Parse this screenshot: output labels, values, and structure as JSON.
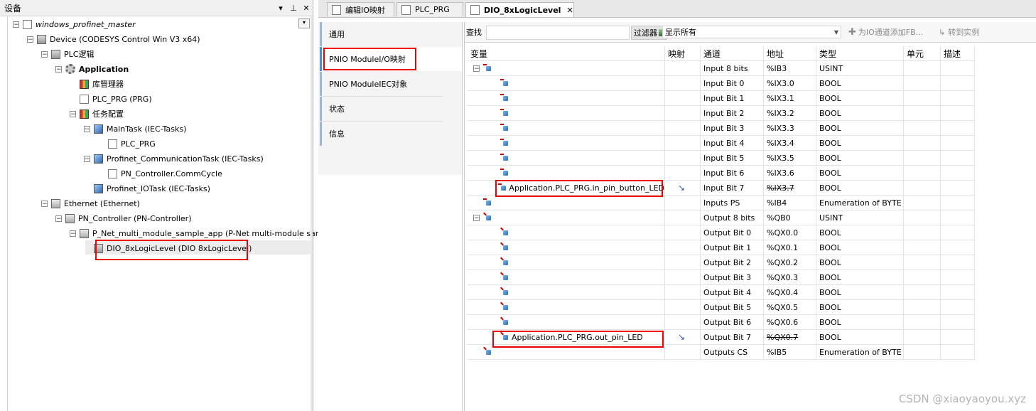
{
  "left_pane": {
    "title": "设备",
    "buttons": [
      "▾",
      "⊥",
      "✕"
    ],
    "tree": [
      {
        "label": "windows_profinet_master",
        "icon": "project-icon",
        "style": "italic"
      },
      {
        "label": "Device (CODESYS Control Win V3 x64)",
        "icon": "device-icon"
      },
      {
        "label": "PLC逻辑",
        "icon": "plc-logic-icon"
      },
      {
        "label": "Application",
        "icon": "application-gear-icon",
        "style": "bold"
      },
      {
        "label": "库管理器",
        "icon": "library-manager-icon"
      },
      {
        "label": "PLC_PRG (PRG)",
        "icon": "pou-icon"
      },
      {
        "label": "任务配置",
        "icon": "task-config-icon"
      },
      {
        "label": "MainTask (IEC-Tasks)",
        "icon": "task-icon"
      },
      {
        "label": "PLC_PRG",
        "icon": "pou-call-icon"
      },
      {
        "label": "Profinet_CommunicationTask (IEC-Tasks)",
        "icon": "task-icon"
      },
      {
        "label": "PN_Controller.CommCycle",
        "icon": "pou-call-icon"
      },
      {
        "label": "Profinet_IOTask (IEC-Tasks)",
        "icon": "task-icon"
      },
      {
        "label": "Ethernet (Ethernet)",
        "icon": "ethernet-icon"
      },
      {
        "label": "PN_Controller (PN-Controller)",
        "icon": "pn-controller-icon"
      },
      {
        "label": "P_Net_multi_module_sample_app (P-Net multi-module sample ap",
        "icon": "pn-device-icon"
      },
      {
        "label": "DIO_8xLogicLevel (DIO 8xLogicLevel)",
        "icon": "module-icon"
      }
    ]
  },
  "tabs": [
    {
      "label": "编辑IO映射"
    },
    {
      "label": "PLC_PRG"
    },
    {
      "label": "DIO_8xLogicLevel",
      "close": "✕"
    }
  ],
  "side_tabs": [
    "通用",
    "PNIO ModuleI/O映射",
    "PNIO ModuleIEC对象",
    "状态",
    "信息"
  ],
  "filterbar": {
    "find_label": "查找",
    "filter_label": "过滤器",
    "filter_value": "显示所有",
    "add_fb_label": "为IO通道添加FB...",
    "goto_instance_label": "转到实例"
  },
  "grid": {
    "headers": [
      "变量",
      "映射",
      "通道",
      "地址",
      "类型",
      "单元",
      "描述"
    ],
    "rows": [
      {
        "variable": "",
        "mapping": "",
        "channel": "Input 8 bits",
        "address": "%IB3",
        "type": "USINT",
        "kind": "in",
        "level": 0,
        "expand": "⊟"
      },
      {
        "variable": "",
        "mapping": "",
        "channel": "Input Bit 0",
        "address": "%IX3.0",
        "type": "BOOL",
        "kind": "in",
        "level": 1
      },
      {
        "variable": "",
        "mapping": "",
        "channel": "Input Bit 1",
        "address": "%IX3.1",
        "type": "BOOL",
        "kind": "in",
        "level": 1
      },
      {
        "variable": "",
        "mapping": "",
        "channel": "Input Bit 2",
        "address": "%IX3.2",
        "type": "BOOL",
        "kind": "in",
        "level": 1
      },
      {
        "variable": "",
        "mapping": "",
        "channel": "Input Bit 3",
        "address": "%IX3.3",
        "type": "BOOL",
        "kind": "in",
        "level": 1
      },
      {
        "variable": "",
        "mapping": "",
        "channel": "Input Bit 4",
        "address": "%IX3.4",
        "type": "BOOL",
        "kind": "in",
        "level": 1
      },
      {
        "variable": "",
        "mapping": "",
        "channel": "Input Bit 5",
        "address": "%IX3.5",
        "type": "BOOL",
        "kind": "in",
        "level": 1
      },
      {
        "variable": "",
        "mapping": "",
        "channel": "Input Bit 6",
        "address": "%IX3.6",
        "type": "BOOL",
        "kind": "in",
        "level": 1
      },
      {
        "variable": "Application.PLC_PRG.in_pin_button_LED",
        "mapping": "map-existing-variable-icon",
        "channel": "Input Bit 7",
        "address": "%IX3.7",
        "type": "BOOL",
        "kind": "in",
        "level": 1,
        "strike": true
      },
      {
        "variable": "",
        "mapping": "",
        "channel": "Inputs PS",
        "address": "%IB4",
        "type": "Enumeration of BYTE",
        "kind": "in",
        "level": 0
      },
      {
        "variable": "",
        "mapping": "",
        "channel": "Output 8 bits",
        "address": "%QB0",
        "type": "USINT",
        "kind": "out",
        "level": 0,
        "expand": "⊟"
      },
      {
        "variable": "",
        "mapping": "",
        "channel": "Output Bit 0",
        "address": "%QX0.0",
        "type": "BOOL",
        "kind": "out",
        "level": 1
      },
      {
        "variable": "",
        "mapping": "",
        "channel": "Output Bit 1",
        "address": "%QX0.1",
        "type": "BOOL",
        "kind": "out",
        "level": 1
      },
      {
        "variable": "",
        "mapping": "",
        "channel": "Output Bit 2",
        "address": "%QX0.2",
        "type": "BOOL",
        "kind": "out",
        "level": 1
      },
      {
        "variable": "",
        "mapping": "",
        "channel": "Output Bit 3",
        "address": "%QX0.3",
        "type": "BOOL",
        "kind": "out",
        "level": 1
      },
      {
        "variable": "",
        "mapping": "",
        "channel": "Output Bit 4",
        "address": "%QX0.4",
        "type": "BOOL",
        "kind": "out",
        "level": 1
      },
      {
        "variable": "",
        "mapping": "",
        "channel": "Output Bit 5",
        "address": "%QX0.5",
        "type": "BOOL",
        "kind": "out",
        "level": 1
      },
      {
        "variable": "",
        "mapping": "",
        "channel": "Output Bit 6",
        "address": "%QX0.6",
        "type": "BOOL",
        "kind": "out",
        "level": 1
      },
      {
        "variable": "Application.PLC_PRG.out_pin_LED",
        "mapping": "map-existing-variable-icon",
        "channel": "Output Bit 7",
        "address": "%QX0.7",
        "type": "BOOL",
        "kind": "out",
        "level": 1,
        "strike": true
      },
      {
        "variable": "",
        "mapping": "",
        "channel": "Outputs CS",
        "address": "%IB5",
        "type": "Enumeration of BYTE",
        "kind": "out",
        "level": 0
      }
    ]
  },
  "watermark": "CSDN @xiaoyaoyou.xyz",
  "colors": {
    "highlight": "#e00000",
    "accent": "#4a90d9"
  }
}
